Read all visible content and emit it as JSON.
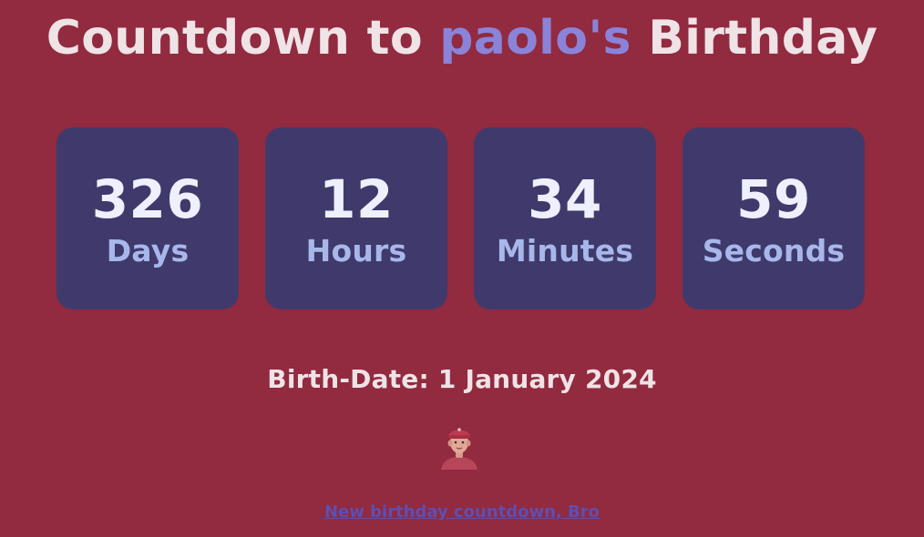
{
  "header": {
    "prefix": "Countdown to ",
    "name": "paolo's",
    "suffix": " Birthday"
  },
  "countdown": [
    {
      "value": "326",
      "unit": "Days"
    },
    {
      "value": "12",
      "unit": "Hours"
    },
    {
      "value": "34",
      "unit": "Minutes"
    },
    {
      "value": "59",
      "unit": "Seconds"
    }
  ],
  "birth_date": {
    "text": "Birth-Date: 1 January 2024"
  },
  "avatar": {
    "icon": "person-avatar-icon"
  },
  "footer": {
    "link_text": "New birthday countdown, Bro"
  },
  "colors": {
    "background": "#922a40",
    "card": "#3f3a6b",
    "accent_name": "#8b83d8",
    "number": "#eef0ff",
    "unit": "#a8b7ea",
    "link": "#5e4fb0"
  }
}
